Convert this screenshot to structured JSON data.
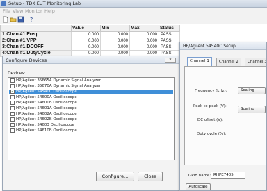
{
  "app": {
    "title": "Setup - TDK EUT Monitoring Lab"
  },
  "menu": [
    "File",
    "View",
    "Monitor",
    "Help"
  ],
  "toolbar": {
    "icons": [
      "new-file-icon",
      "open-folder-icon",
      "save-icon",
      "help-icon"
    ]
  },
  "table": {
    "columns": [
      "",
      "Value",
      "Min",
      "Max",
      "Status"
    ],
    "rows": [
      {
        "name": "1:Chan #1 Freq",
        "value": "0.000",
        "min": "0.000",
        "max": "0.000",
        "status": "PASS"
      },
      {
        "name": "2:Chan #1 VPP",
        "value": "0.000",
        "min": "0.000",
        "max": "0.000",
        "status": "PASS"
      },
      {
        "name": "3:Chan #1 DCOFF",
        "value": "0.000",
        "min": "0.000",
        "max": "0.000",
        "status": "PASS"
      },
      {
        "name": "4:Chan #1 DutyCycle",
        "value": "0.000",
        "min": "0.000",
        "max": "0.000",
        "status": "PASS"
      }
    ]
  },
  "configure": {
    "title": "Configure Devices",
    "devices_label": "Devices:",
    "devices": [
      {
        "label": "HP/Agilent 35665A Dynamic Signal Analyzer",
        "checked": false,
        "selected": false
      },
      {
        "label": "HP/Agilent 35670A Dynamic Signal Analyzer",
        "checked": false,
        "selected": false
      },
      {
        "label": "HP/Agilent 54540C Oscilloscope",
        "checked": true,
        "selected": true
      },
      {
        "label": "HP/Agilent 54600A Oscilloscope",
        "checked": false,
        "selected": false
      },
      {
        "label": "HP/Agilent 54600B Oscilloscope",
        "checked": false,
        "selected": false
      },
      {
        "label": "HP/Agilent 54601A Oscilloscope",
        "checked": false,
        "selected": false
      },
      {
        "label": "HP/Agilent 54602A Oscilloscope",
        "checked": false,
        "selected": false
      },
      {
        "label": "HP/Agilent 54602B Oscilloscope",
        "checked": false,
        "selected": false
      },
      {
        "label": "HP/Agilent 54603 Oscilloscope",
        "checked": false,
        "selected": false
      },
      {
        "label": "HP/Agilent 54610B Oscilloscope",
        "checked": false,
        "selected": false
      }
    ],
    "configure_button": "Configure...",
    "close_button": "Close"
  },
  "setup": {
    "title": "HP/Agilent 54540C Setup",
    "tabs": [
      "Channel 1",
      "Channel 2",
      "Channel 3"
    ],
    "fields": {
      "frequency": "Frequency (kHz):",
      "peak_to_peak": "Peak-to-peak (V):",
      "dc_offset": "DC offset (V):",
      "duty_cycle": "Duty cycle (%):"
    },
    "scaling_label": "Scaling",
    "gpib_label": "GPIB name:",
    "gpib_value": "RHPE7405",
    "autoscale_label": "Autoscale"
  },
  "colors": {
    "selection": "#3f8fd8",
    "titlebar": "#d9e1ec"
  }
}
